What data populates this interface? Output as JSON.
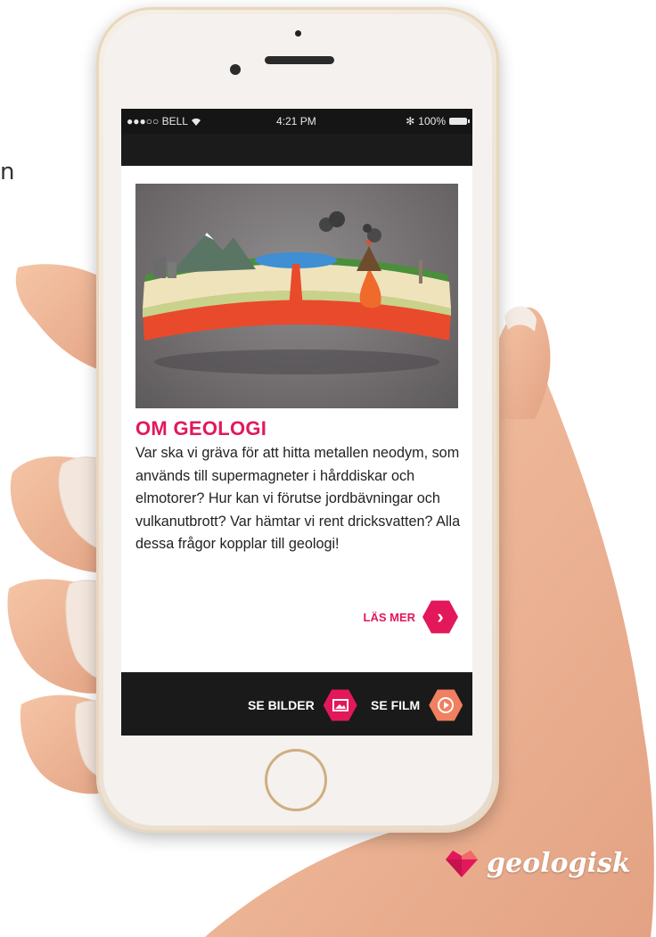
{
  "edge_text": "n",
  "status_bar": {
    "carrier": "●●●○○ BELL",
    "wifi_icon": "wifi-icon",
    "time": "4:21 PM",
    "bluetooth": "✻",
    "battery": "100%"
  },
  "article": {
    "title": "OM GEOLOGI",
    "body": "Var ska vi gräva för att hitta metallen neodym, som används till supermagneter i hårddiskar och elmotorer? Hur kan vi förutse jordbävningar och vulkanutbrott? Var hämtar vi rent dricksvatten? Alla dessa frågor kopplar till geologi!",
    "read_more_label": "LÄS MER",
    "read_more_icon": "chevron-right-icon"
  },
  "bottom_bar": {
    "images_label": "SE BILDER",
    "images_icon": "image-icon",
    "film_label": "SE FILM",
    "film_icon": "play-icon"
  },
  "logo": {
    "text": "geologisk",
    "icon": "heart-gem-icon"
  },
  "colors": {
    "accent": "#e2185b",
    "film_accent": "#f0805f",
    "bar": "#1a1a1a"
  }
}
